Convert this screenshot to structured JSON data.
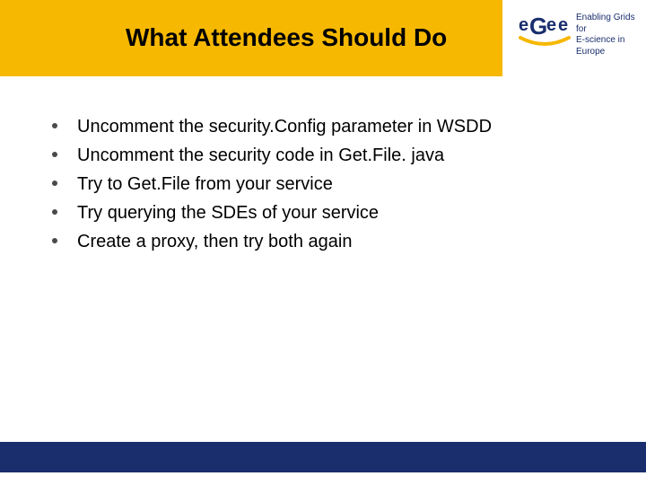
{
  "slide": {
    "title": "What Attendees Should Do",
    "bullets": [
      "Uncomment the security.Config parameter in WSDD",
      "Uncomment the security code in Get.File. java",
      "Try to Get.File from your service",
      "Try querying the SDEs of your service",
      "Create a proxy, then try both again"
    ]
  },
  "logo": {
    "acronym": "eGee",
    "line1": "Enabling Grids for",
    "line2": "E-science in Europe"
  },
  "colors": {
    "header": "#f6b800",
    "footer": "#1a2e6e",
    "logo_primary": "#1a2e6e",
    "logo_accent": "#f6b800"
  }
}
